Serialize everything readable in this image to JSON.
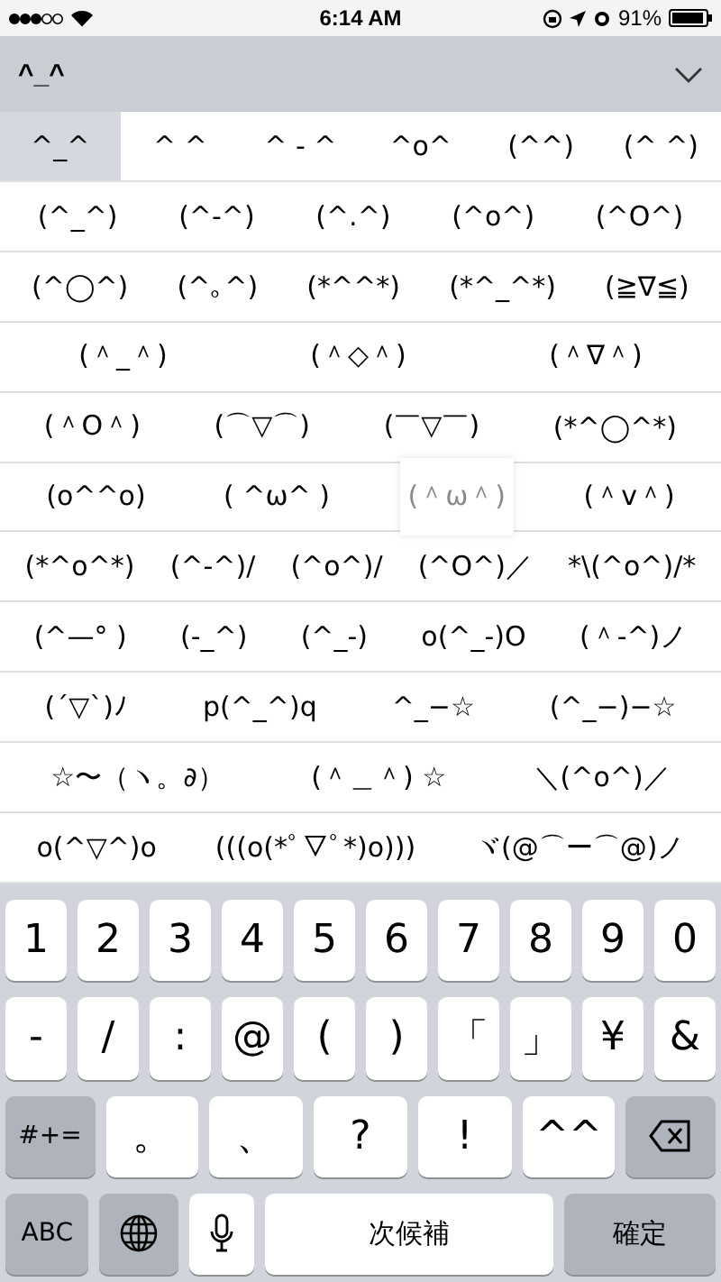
{
  "status_bar": {
    "time": "6:14 AM",
    "battery": "91%"
  },
  "input_bar": {
    "text": "^_^"
  },
  "candidates": [
    [
      {
        "text": "^_^",
        "selected": true,
        "pressed": false
      },
      {
        "text": "^ ^",
        "selected": false,
        "pressed": false
      },
      {
        "text": "^ - ^",
        "selected": false,
        "pressed": false
      },
      {
        "text": "^o^",
        "selected": false,
        "pressed": false
      },
      {
        "text": "(^^)",
        "selected": false,
        "pressed": false
      },
      {
        "text": "(^ ^)",
        "selected": false,
        "pressed": false
      }
    ],
    [
      {
        "text": "(^_^)",
        "selected": false,
        "pressed": false
      },
      {
        "text": "(^-^)",
        "selected": false,
        "pressed": false
      },
      {
        "text": "(^.^)",
        "selected": false,
        "pressed": false
      },
      {
        "text": "(^o^)",
        "selected": false,
        "pressed": false
      },
      {
        "text": "(^O^)",
        "selected": false,
        "pressed": false
      }
    ],
    [
      {
        "text": "(^◯^)",
        "selected": false,
        "pressed": false
      },
      {
        "text": "(^｡^)",
        "selected": false,
        "pressed": false
      },
      {
        "text": "(*^^*)",
        "selected": false,
        "pressed": false
      },
      {
        "text": "(*^_^*)",
        "selected": false,
        "pressed": false
      },
      {
        "text": "(≧∇≦)",
        "selected": false,
        "pressed": false
      }
    ],
    [
      {
        "text": "(＾_＾)",
        "selected": false,
        "pressed": false
      },
      {
        "text": "(＾◇＾)",
        "selected": false,
        "pressed": false
      },
      {
        "text": "(＾∇＾)",
        "selected": false,
        "pressed": false
      }
    ],
    [
      {
        "text": "(＾O＾)",
        "selected": false,
        "pressed": false
      },
      {
        "text": "(⌒▽⌒)",
        "selected": false,
        "pressed": false
      },
      {
        "text": "(￣▽￣)",
        "selected": false,
        "pressed": false
      },
      {
        "text": "(*^◯^*)",
        "selected": false,
        "pressed": false
      }
    ],
    [
      {
        "text": "(o^^o)",
        "selected": false,
        "pressed": false
      },
      {
        "text": "( ^ω^ )",
        "selected": false,
        "pressed": false
      },
      {
        "text": "(＾ω＾)",
        "selected": false,
        "pressed": true
      },
      {
        "text": "(＾v＾)",
        "selected": false,
        "pressed": false
      }
    ],
    [
      {
        "text": "(*^o^*)",
        "selected": false,
        "pressed": false
      },
      {
        "text": "(^-^)/",
        "selected": false,
        "pressed": false
      },
      {
        "text": "(^o^)/",
        "selected": false,
        "pressed": false
      },
      {
        "text": "(^O^)／",
        "selected": false,
        "pressed": false
      },
      {
        "text": "*\\(^o^)/*",
        "selected": false,
        "pressed": false
      }
    ],
    [
      {
        "text": "(^—° )",
        "selected": false,
        "pressed": false
      },
      {
        "text": "(-_^)",
        "selected": false,
        "pressed": false
      },
      {
        "text": "(^_-)",
        "selected": false,
        "pressed": false
      },
      {
        "text": "o(^_-)O",
        "selected": false,
        "pressed": false
      },
      {
        "text": "(＾-^)ノ",
        "selected": false,
        "pressed": false
      }
    ],
    [
      {
        "text": "(´▽`)ﾉ",
        "selected": false,
        "pressed": false
      },
      {
        "text": "p(^_^)q",
        "selected": false,
        "pressed": false
      },
      {
        "text": "^_−☆",
        "selected": false,
        "pressed": false
      },
      {
        "text": "(^_−)−☆",
        "selected": false,
        "pressed": false
      }
    ],
    [
      {
        "text": "☆〜（ヽ。∂）",
        "selected": false,
        "pressed": false
      },
      {
        "text": "(＾＿＾) ☆",
        "selected": false,
        "pressed": false
      },
      {
        "text": "＼(^o^)／",
        "selected": false,
        "pressed": false
      }
    ],
    [
      {
        "text": "o(^▽^)o",
        "selected": false,
        "pressed": false
      },
      {
        "text": "(((o(*ﾟ▽ﾟ*)o)))",
        "selected": false,
        "pressed": false
      },
      {
        "text": "ヾ(@⌒ー⌒@)ノ",
        "selected": false,
        "pressed": false
      }
    ]
  ],
  "keyboard": [
    [
      {
        "kind": "char",
        "label": "1"
      },
      {
        "kind": "char",
        "label": "2"
      },
      {
        "kind": "char",
        "label": "3"
      },
      {
        "kind": "char",
        "label": "4"
      },
      {
        "kind": "char",
        "label": "5"
      },
      {
        "kind": "char",
        "label": "6"
      },
      {
        "kind": "char",
        "label": "7"
      },
      {
        "kind": "char",
        "label": "8"
      },
      {
        "kind": "char",
        "label": "9"
      },
      {
        "kind": "char",
        "label": "0"
      }
    ],
    [
      {
        "kind": "char",
        "label": "-"
      },
      {
        "kind": "char",
        "label": "/"
      },
      {
        "kind": "char",
        "label": ":"
      },
      {
        "kind": "char",
        "label": "@"
      },
      {
        "kind": "char",
        "label": "("
      },
      {
        "kind": "char",
        "label": ")"
      },
      {
        "kind": "char",
        "label": "「"
      },
      {
        "kind": "char",
        "label": "」"
      },
      {
        "kind": "char",
        "label": "¥"
      },
      {
        "kind": "char",
        "label": "&"
      }
    ],
    [
      {
        "kind": "function",
        "label": "#+="
      },
      {
        "kind": "wide",
        "label": "。"
      },
      {
        "kind": "wide",
        "label": "、"
      },
      {
        "kind": "wide",
        "label": "?"
      },
      {
        "kind": "wide",
        "label": "!"
      },
      {
        "kind": "wide",
        "label": "^^"
      },
      {
        "kind": "delete"
      }
    ],
    [
      {
        "kind": "function",
        "label": "ABC"
      },
      {
        "kind": "globe"
      },
      {
        "kind": "mic"
      },
      {
        "kind": "space",
        "label": "次候補"
      },
      {
        "kind": "confirm",
        "label": "確定"
      }
    ]
  ]
}
